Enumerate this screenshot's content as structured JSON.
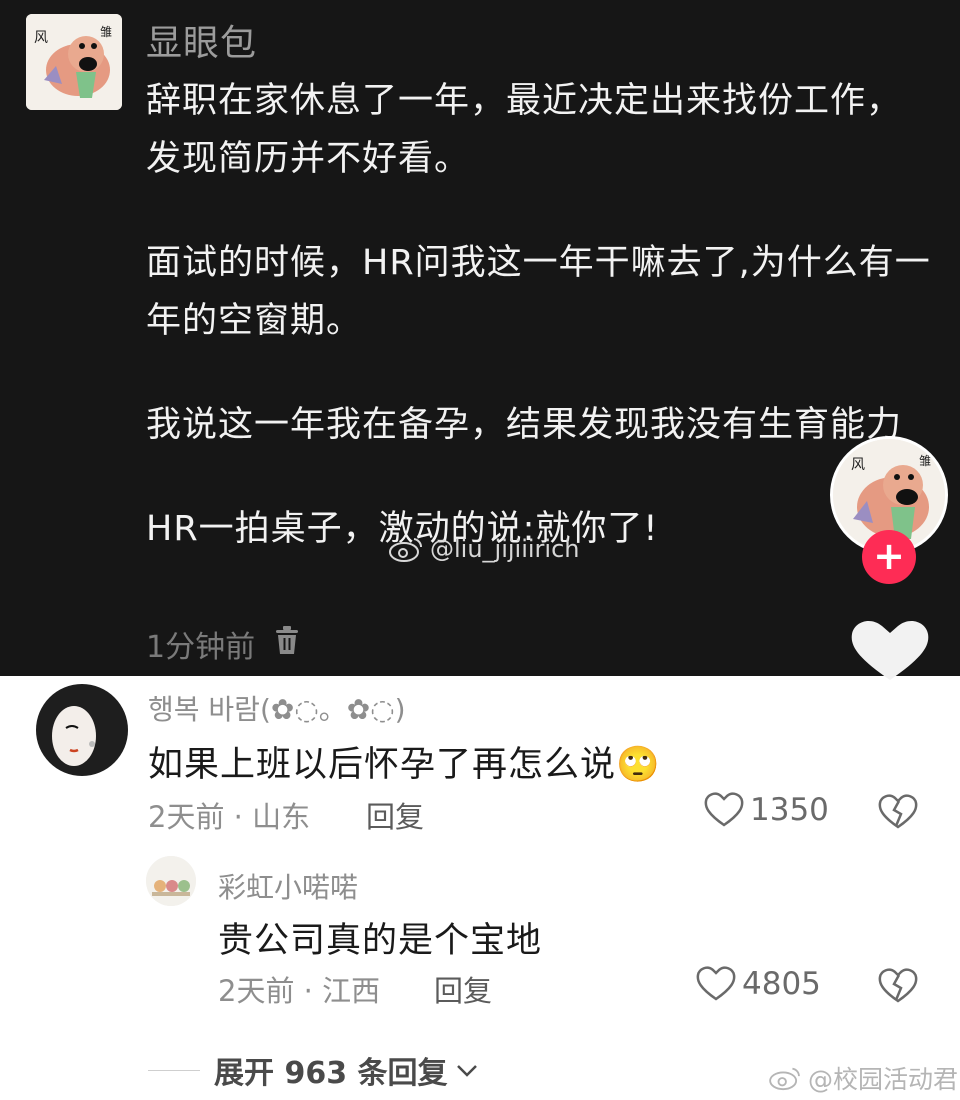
{
  "post": {
    "username": "显眼包",
    "paragraphs": [
      "辞职在家休息了一年，最近决定出来找份工作，发现简历并不好看。",
      "面试的时候，HR问我这一年干嘛去了,为什么有一年的空窗期。",
      "我说这一年我在备孕，结果发现我没有生育能力",
      "HR一拍桌子，激动的说:就你了!"
    ],
    "time": "1分钟前",
    "watermark": "@liu_jijiiirich",
    "avatar_text_left": "风",
    "avatar_text_right": "雏"
  },
  "comments": [
    {
      "username": "행복 바람(✿◌。✿◌)",
      "text": "如果上班以后怀孕了再怎么说",
      "emoji": "🙄",
      "meta": "2天前 · 山东",
      "reply": "回复",
      "likes": "1350"
    },
    {
      "username": "彩虹小喏喏",
      "text": "贵公司真的是个宝地",
      "meta": "2天前 · 江西",
      "reply": "回复",
      "likes": "4805"
    }
  ],
  "expand_text": "展开 963 条回复",
  "bottom_watermark": "@校园活动君",
  "colors": {
    "dark_bg": "#161616",
    "follow": "#fe2c55"
  },
  "icons": [
    "trash-icon",
    "plus-icon",
    "heart-icon",
    "broken-heart-icon",
    "chevron-down-icon",
    "weibo-icon"
  ]
}
